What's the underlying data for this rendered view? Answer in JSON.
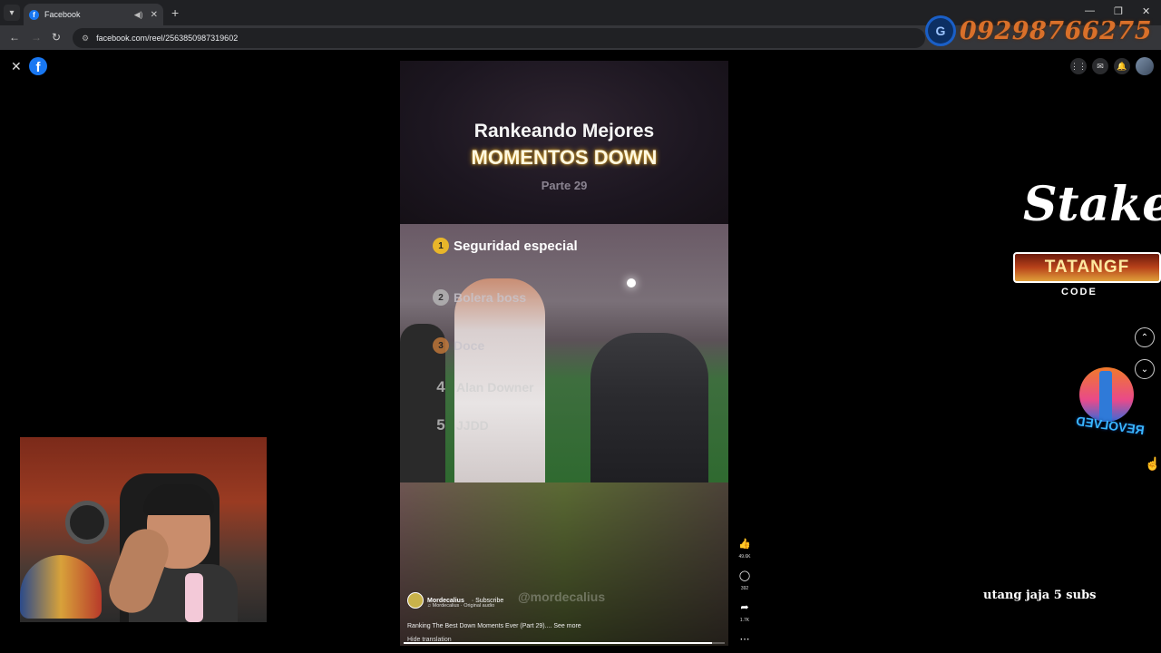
{
  "browser": {
    "tab_title": "Facebook",
    "new_tab": "+",
    "url": "facebook.com/reel/2563850987319602",
    "window_controls": [
      "—",
      "❐",
      "✕"
    ]
  },
  "overlay": {
    "phone_number": "09298766275"
  },
  "header": {
    "close_label": "✕",
    "fb_logo": "f"
  },
  "reel": {
    "title_line1": "Rankeando Mejores",
    "title_line2": "MOMENTOS DOWN",
    "subtitle": "Parte 29",
    "rankings": [
      {
        "rank": "1",
        "label": "Seguridad especial"
      },
      {
        "rank": "2",
        "label": "Bolera boss"
      },
      {
        "rank": "3",
        "label": "Doce"
      },
      {
        "rank": "4",
        "label": "Alan Downer"
      },
      {
        "rank": "5",
        "label": "JJDD"
      }
    ],
    "watermark": "@mordecalius",
    "author": "Mordecalius",
    "subscribe_label": "· Subscribe",
    "audio": "♫ Mordecalius · Original audio",
    "caption": "Ranking The Best Down Moments Ever (Part 29)....",
    "see_more": "See more",
    "hide_translation": "Hide translation",
    "progress": 0.96
  },
  "actions": {
    "likes": "49.6K",
    "comments": "392",
    "shares": "1.7K"
  },
  "sidebar": {
    "brand": "Stake",
    "promo_code": "TATANGF",
    "promo_label": "CODE",
    "logo_text": "REVOLVED",
    "subs_text": "utang jaja  5 subs"
  },
  "colors": {
    "facebook_blue": "#1877f2",
    "phone_orange": "#d9702a",
    "browser_bg": "#202124"
  }
}
